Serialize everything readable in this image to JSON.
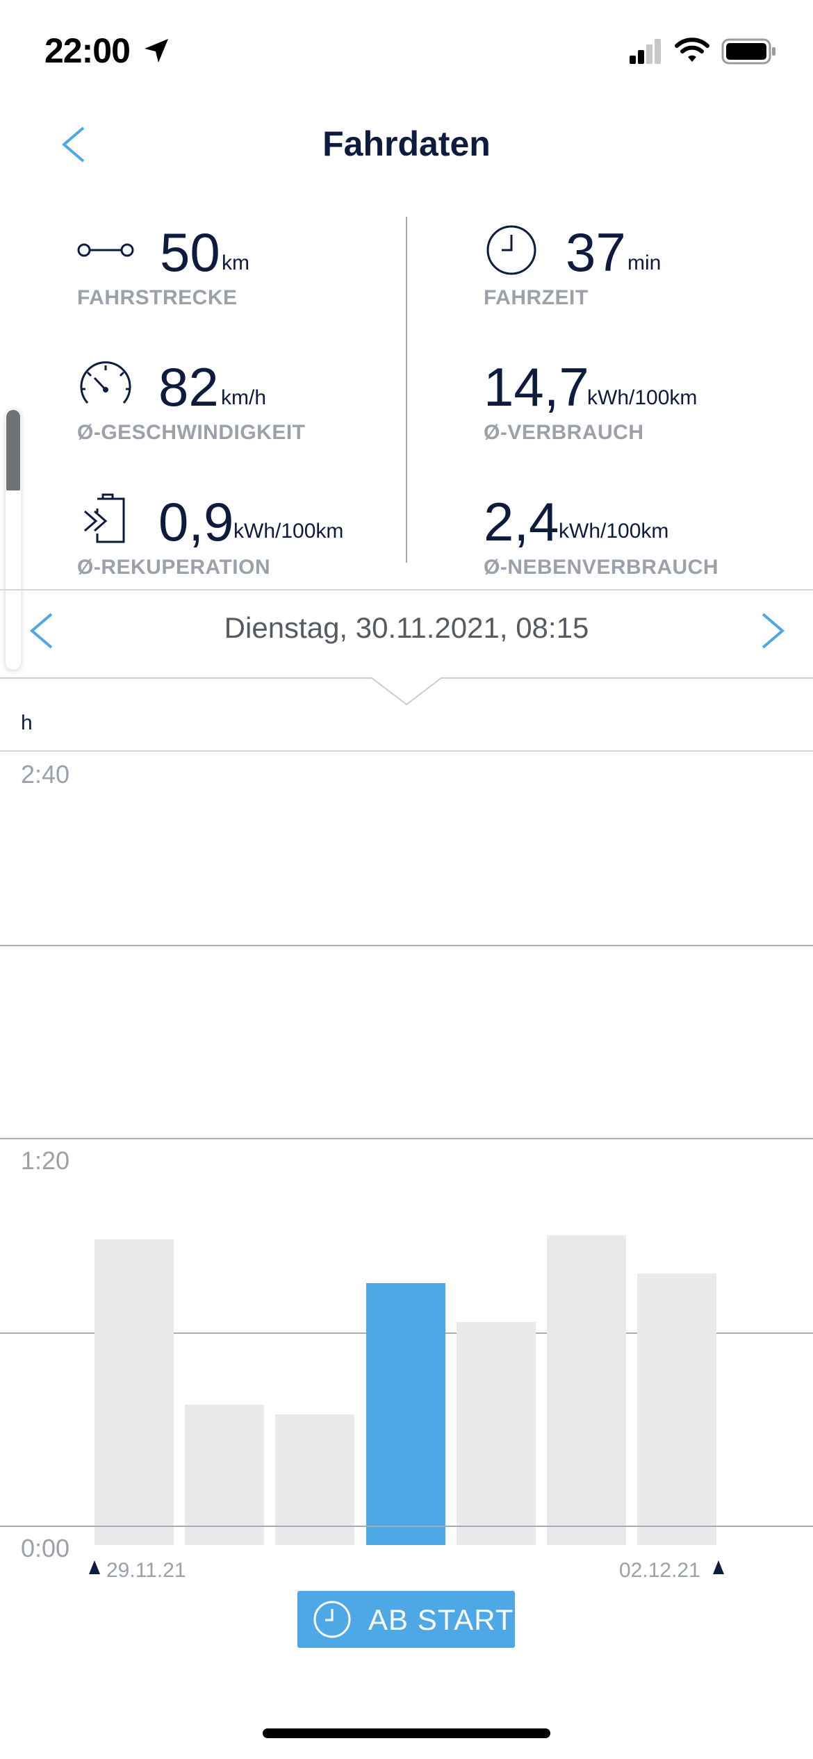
{
  "status_bar": {
    "time": "22:00"
  },
  "header": {
    "title": "Fahrdaten"
  },
  "stats": [
    {
      "value": "50",
      "unit": "km",
      "label": "FAHRSTRECKE",
      "icon": "route-icon"
    },
    {
      "value": "37",
      "unit": "min",
      "label": "FAHRZEIT",
      "icon": "clock-icon"
    },
    {
      "value": "82",
      "unit": "km/h",
      "label": "Ø-GESCHWINDIGKEIT",
      "icon": "speedometer-icon"
    },
    {
      "value": "14,7",
      "unit": "kWh/100km",
      "label": "Ø-VERBRAUCH",
      "icon": ""
    },
    {
      "value": "0,9",
      "unit": "kWh/100km",
      "label": "Ø-REKUPERATION",
      "icon": "recuperation-icon"
    },
    {
      "value": "2,4",
      "unit": "kWh/100km",
      "label": "Ø-NEBENVERBRAUCH",
      "icon": ""
    }
  ],
  "date_nav": {
    "label": "Dienstag, 30.11.2021, 08:15"
  },
  "chart_data": {
    "type": "bar",
    "ylabel": "h",
    "ytick_labels": [
      "2:40",
      "1:20",
      "0:00"
    ],
    "ylim_minutes": [
      0,
      160
    ],
    "values_minutes": [
      59,
      25,
      23,
      50,
      42,
      60,
      52
    ],
    "selected_index": 3,
    "start_label": "29.11.21",
    "end_label": "02.12.21",
    "colors": {
      "bar": "#e9eaec",
      "selected": "#4ea8e6"
    }
  },
  "action_button": {
    "label": "AB START"
  }
}
